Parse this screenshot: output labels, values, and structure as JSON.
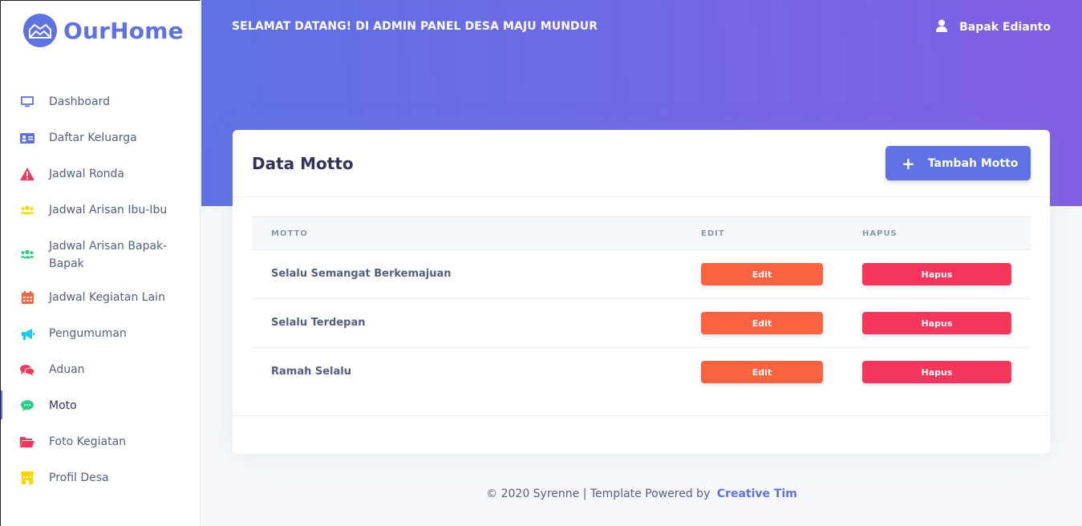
{
  "brand": {
    "name": "OurHome",
    "color": "#5e72e4"
  },
  "sidebar": {
    "items": [
      {
        "label": "Dashboard",
        "icon": "monitor-icon",
        "color": "#5e72e4"
      },
      {
        "label": "Daftar Keluarga",
        "icon": "id-card-icon",
        "color": "#5e72e4"
      },
      {
        "label": "Jadwal Ronda",
        "icon": "warning-icon",
        "color": "#f5365c"
      },
      {
        "label": "Jadwal Arisan Ibu-Ibu",
        "icon": "users-icon",
        "color": "#ffd600"
      },
      {
        "label": "Jadwal Arisan Bapak-Bapak",
        "icon": "users-icon",
        "color": "#2dce89"
      },
      {
        "label": "Jadwal Kegiatan Lain",
        "icon": "calendar-icon",
        "color": "#fb6340"
      },
      {
        "label": "Pengumuman",
        "icon": "megaphone-icon",
        "color": "#11cdef"
      },
      {
        "label": "Aduan",
        "icon": "chat-bubbles-icon",
        "color": "#f5365c"
      },
      {
        "label": "Moto",
        "icon": "speech-bubble-icon",
        "color": "#2dce89",
        "active": true
      },
      {
        "label": "Foto Kegiatan",
        "icon": "folder-open-icon",
        "color": "#f5365c"
      },
      {
        "label": "Profil Desa",
        "icon": "building-icon",
        "color": "#ffd600"
      }
    ]
  },
  "header": {
    "welcome": "SELAMAT DATANG! DI ADMIN PANEL DESA MAJU MUNDUR",
    "user_name": "Bapak Edianto"
  },
  "card": {
    "title": "Data Motto",
    "add_button": "Tambah Motto",
    "columns": [
      "MOTTO",
      "EDIT",
      "HAPUS"
    ],
    "rows": [
      {
        "motto": "Selalu Semangat Berkemajuan",
        "edit": "Edit",
        "delete": "Hapus"
      },
      {
        "motto": "Selalu Terdepan",
        "edit": "Edit",
        "delete": "Hapus"
      },
      {
        "motto": "Ramah Selalu",
        "edit": "Edit",
        "delete": "Hapus"
      }
    ]
  },
  "footer": {
    "text": "© 2020 Syrenne | Template Powered by",
    "link": "Creative Tim"
  }
}
